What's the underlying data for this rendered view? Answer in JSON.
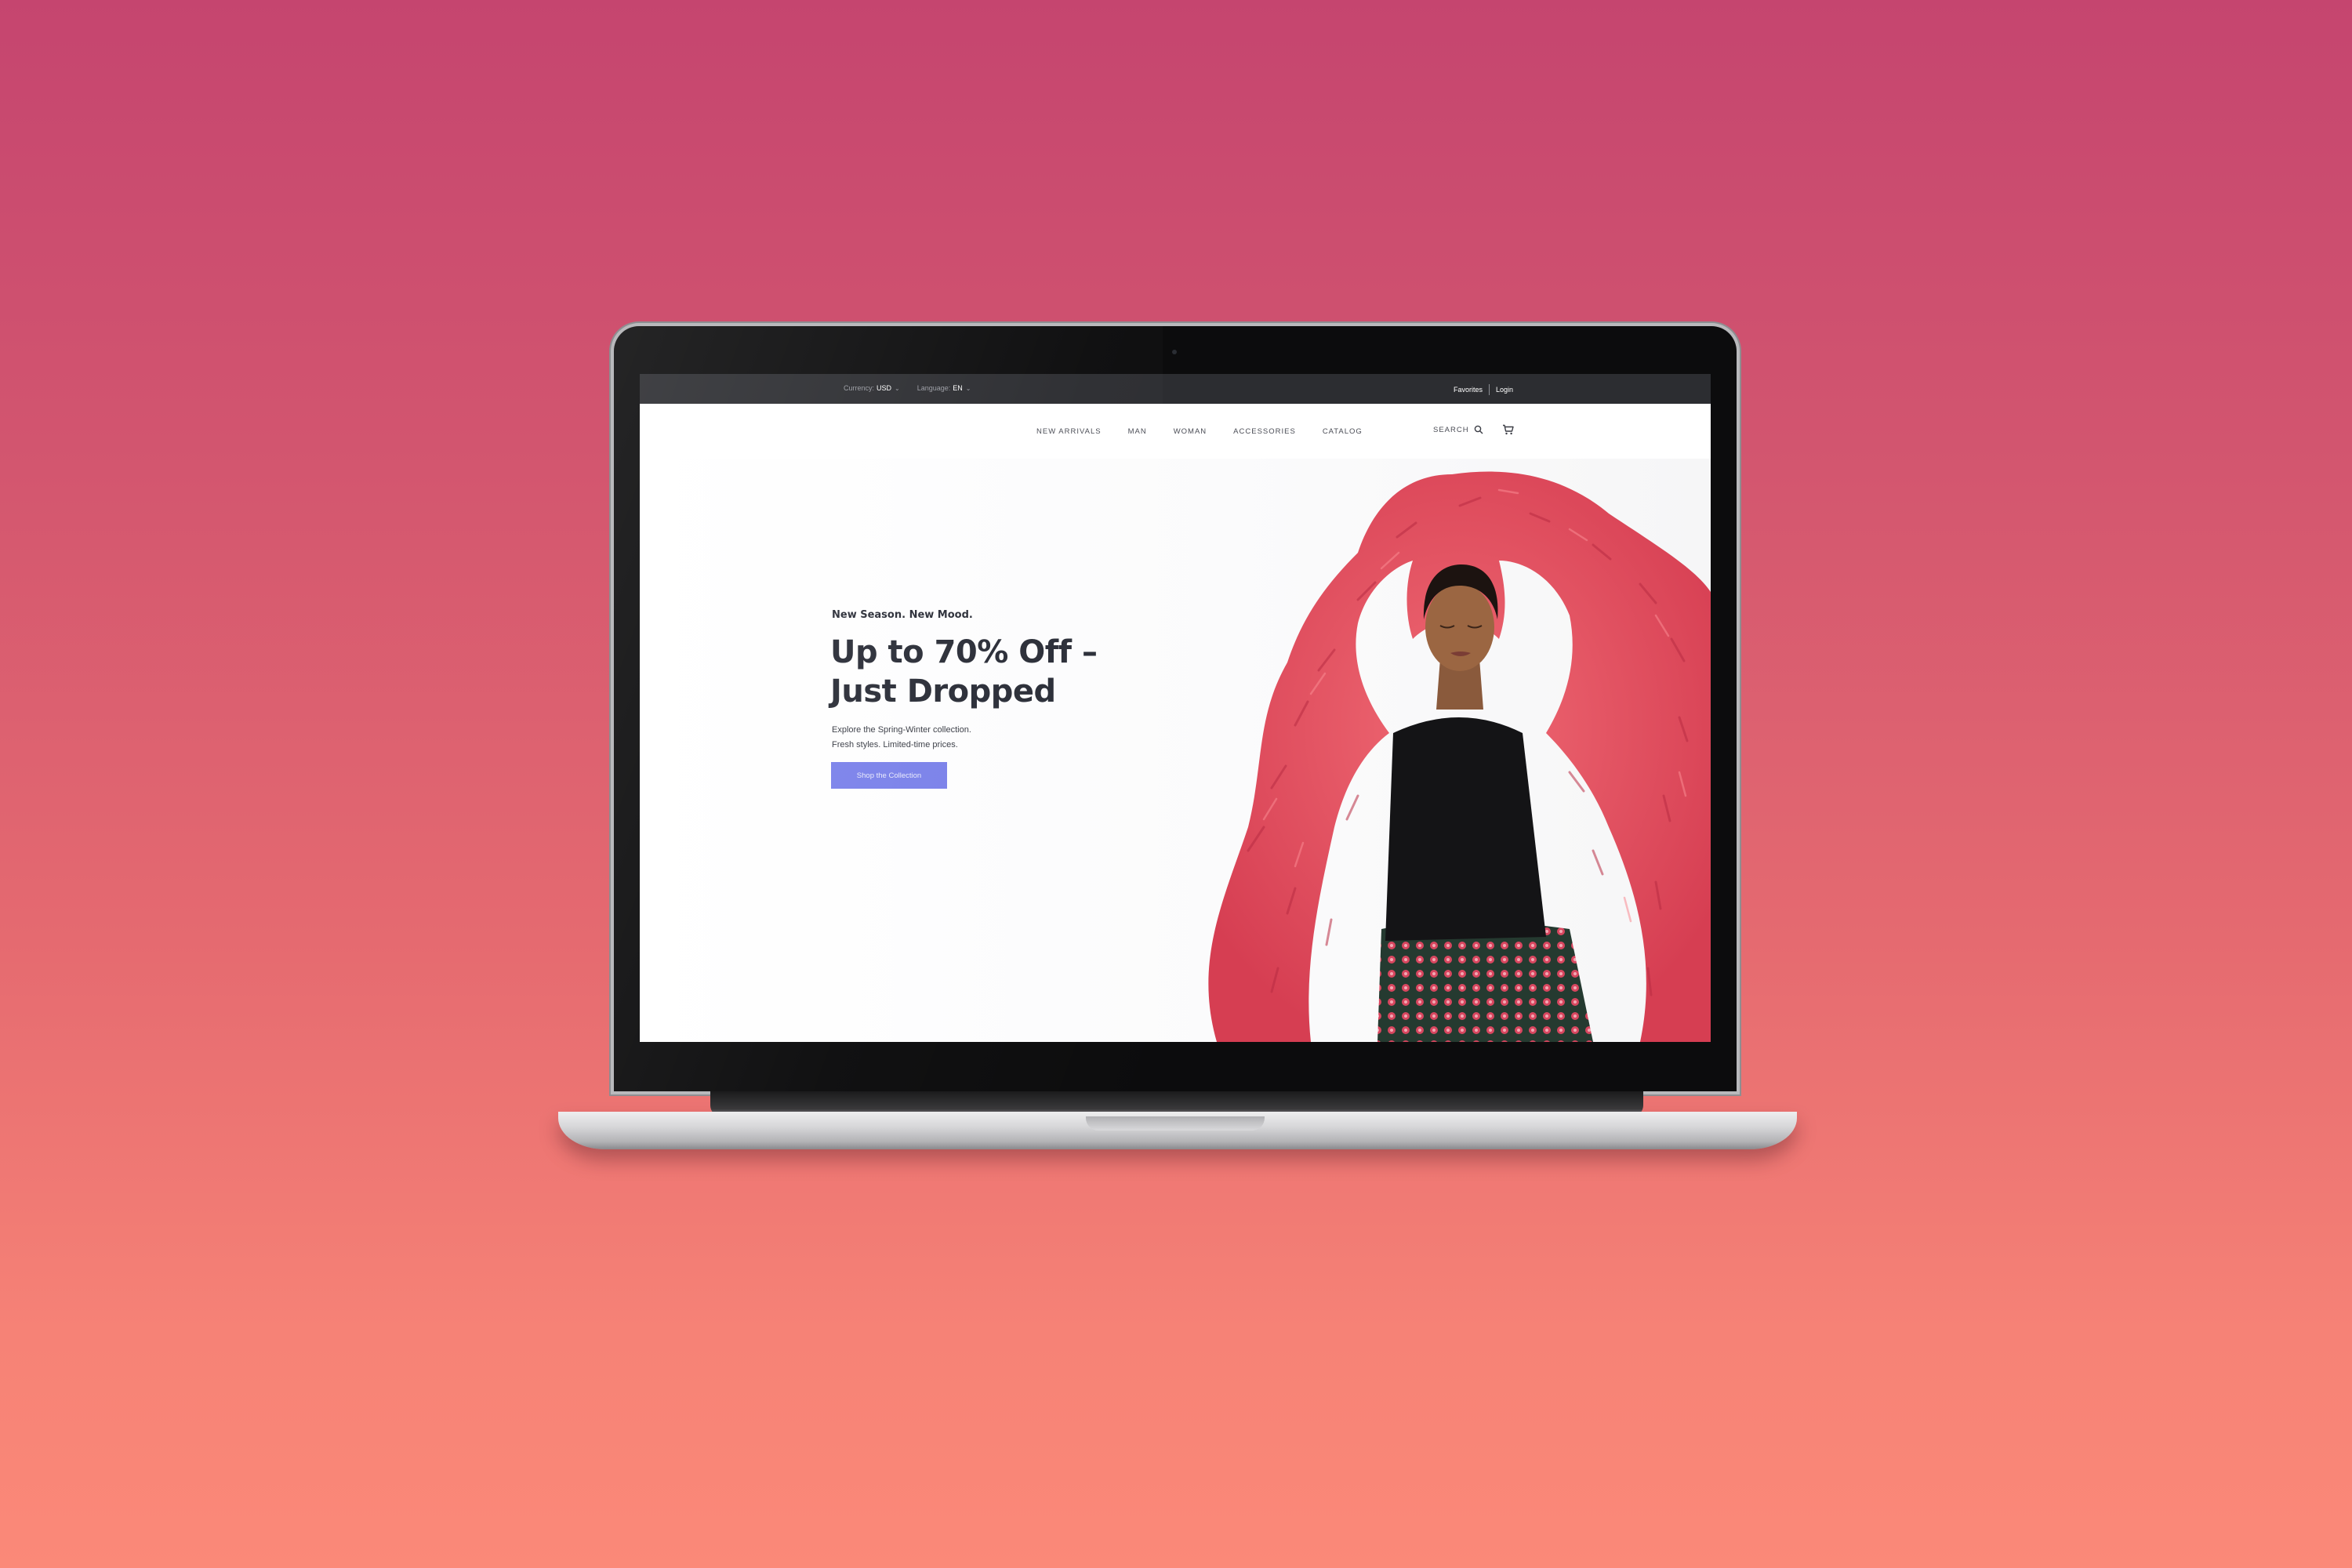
{
  "topbar": {
    "currency_label": "Currency:",
    "currency_value": "USD",
    "language_label": "Language:",
    "language_value": "EN",
    "favorites": "Favorites",
    "login": "Login"
  },
  "nav": {
    "items": [
      "NEW ARRIVALS",
      "MAN",
      "WOMAN",
      "ACCESSORIES",
      "CATALOG"
    ],
    "search_label": "SEARCH",
    "cart_icon": "cart-icon",
    "search_icon": "search-icon"
  },
  "hero": {
    "tagline": "New Season. New Mood.",
    "headline_line1": "Up to 70% Off –",
    "headline_line2": "Just Dropped",
    "desc_line1": "Explore the Spring-Winter collection.",
    "desc_line2": "Fresh styles. Limited-time prices.",
    "cta_label": "Shop the Collection"
  },
  "colors": {
    "background_top": "#c5456f",
    "background_bottom": "#fb8978",
    "topbar": "#2c2d31",
    "accent_button": "#7b82ea",
    "headline_text": "#2b2e38",
    "coat": "#e9505e"
  }
}
